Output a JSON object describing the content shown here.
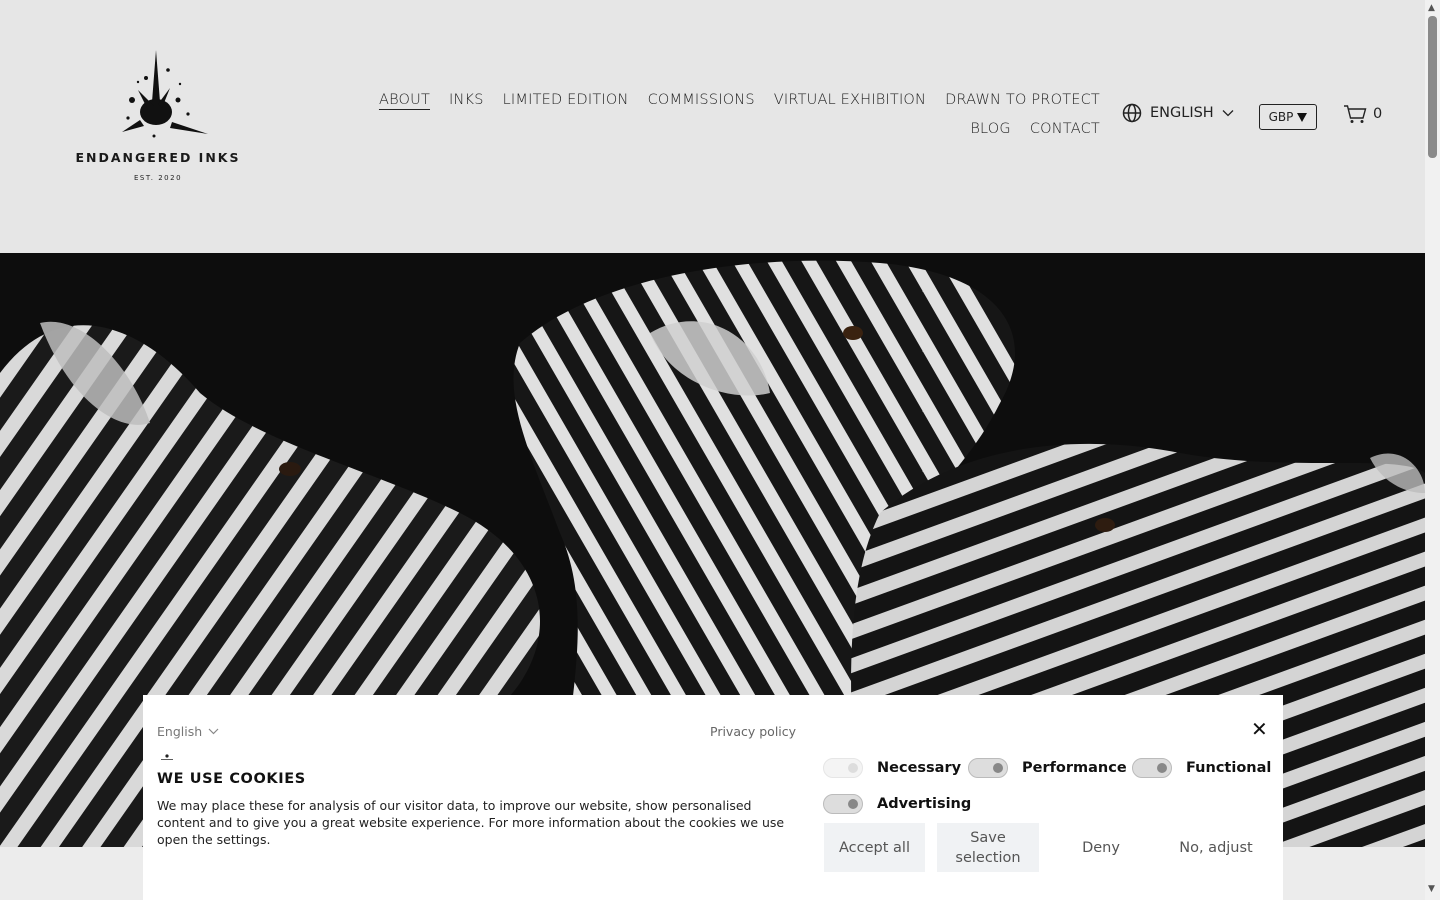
{
  "logo": {
    "name": "ENDANGERED INKS",
    "est": "EST. 2020"
  },
  "nav": {
    "items": [
      "ABOUT",
      "INKS",
      "LIMITED EDITION",
      "COMMISSIONS",
      "VIRTUAL EXHIBITION",
      "DRAWN TO PROTECT",
      "BLOG",
      "CONTACT"
    ],
    "active": "ABOUT"
  },
  "header": {
    "language": "ENGLISH",
    "currency": "GBP",
    "cart_count": "0"
  },
  "cookie": {
    "language": "English",
    "privacy": "Privacy policy",
    "title": "WE USE COOKIES",
    "text": "We may place these for analysis of our visitor data, to improve our website, show personalised content and to give you a great website experience. For more information about the cookies we use open the settings.",
    "toggles": [
      "Necessary",
      "Performance",
      "Functional",
      "Advertising"
    ],
    "buttons": {
      "accept": "Accept all",
      "save": "Save selection",
      "deny": "Deny",
      "adjust": "No, adjust"
    }
  },
  "colors": {
    "header_bg": "#e6e6e6",
    "hero_bg": "#0d0d0d",
    "button_bg": "#f0f2f4"
  },
  "icons": [
    "globe-icon",
    "chevron-down-icon",
    "caret-down-icon",
    "cart-icon",
    "close-icon"
  ]
}
